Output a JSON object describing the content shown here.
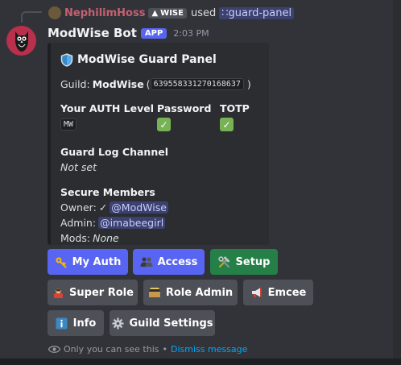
{
  "command": {
    "user": "NephilimHoss",
    "user_tag": "WISE",
    "used_text": "used",
    "command_name": "guard-panel"
  },
  "message": {
    "author": "ModWise Bot",
    "badge": "APP",
    "time": "2:03 PM"
  },
  "embed": {
    "title": "ModWise Guard Panel",
    "guild_label": "Guild:",
    "guild_name": "ModWise",
    "guild_id": "639558331270168637",
    "auth_level_label": "Your AUTH Level",
    "auth_level_value": "MW",
    "password_label": "Password",
    "totp_label": "TOTP",
    "log_channel_label": "Guard Log Channel",
    "log_channel_value": "Not set",
    "secure_members_label": "Secure Members",
    "owner_label": "Owner:",
    "owner_check": "✓",
    "owner_mention": "@ModWise",
    "admin_label": "Admin:",
    "admin_mention": "@imabeegirl",
    "mods_label": "Mods:",
    "mods_value": "None"
  },
  "buttons": {
    "my_auth": "My Auth",
    "access": "Access",
    "setup": "Setup",
    "super_role": "Super Role",
    "role_admin": "Role Admin",
    "emcee": "Emcee",
    "info": "Info",
    "guild_settings": "Guild Settings"
  },
  "footer": {
    "only_you": "Only you can see this",
    "separator": "•",
    "dismiss": "Dismiss message"
  },
  "colors": {
    "primary": "#5865f2",
    "success": "#248046",
    "secondary": "#4e5058",
    "background": "#323339"
  }
}
